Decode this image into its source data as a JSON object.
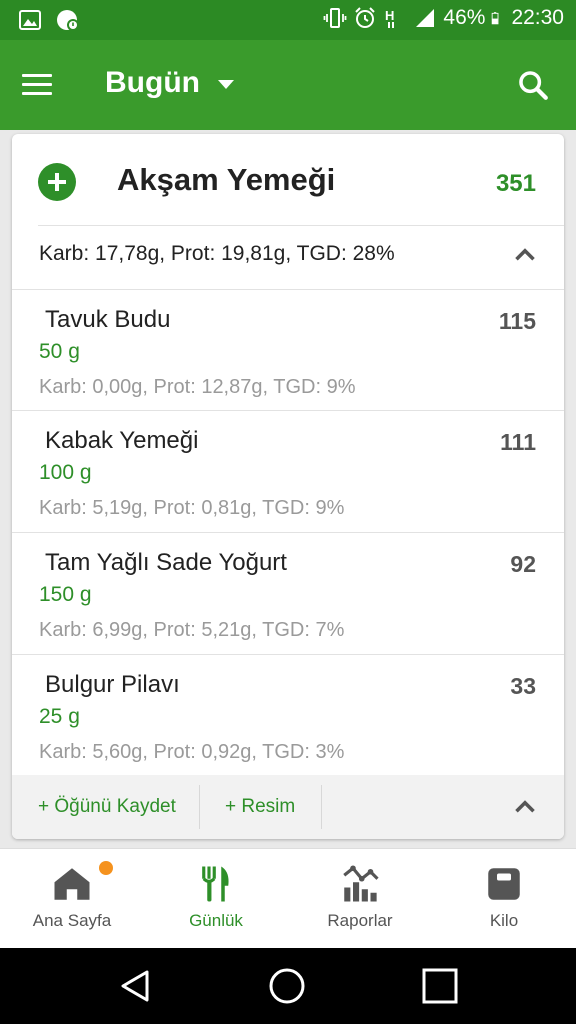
{
  "status_bar": {
    "battery_percent": "46%",
    "time": "22:30",
    "icons": [
      "image-icon",
      "notification-icon",
      "vibrate-icon",
      "alarm-icon",
      "network-h-icon",
      "signal-icon",
      "battery-icon"
    ]
  },
  "app_bar": {
    "title": "Bugün",
    "icons": [
      "menu-icon",
      "dropdown-caret-icon",
      "search-icon"
    ]
  },
  "meal": {
    "title": "Akşam Yemeği",
    "total_kcal": "351",
    "summary": "Karb: 17,78g, Prot: 19,81g, TGD: 28%",
    "items": [
      {
        "name": "Tavuk Budu",
        "qty": "50  g",
        "macros": "Karb: 0,00g, Prot: 12,87g, TGD: 9%",
        "kcal": "115"
      },
      {
        "name": "Kabak Yemeği",
        "qty": "100  g",
        "macros": "Karb: 5,19g, Prot: 0,81g, TGD: 9%",
        "kcal": "111"
      },
      {
        "name": "Tam Yağlı Sade Yoğurt",
        "qty": "150  g",
        "macros": "Karb: 6,99g, Prot: 5,21g, TGD: 7%",
        "kcal": "92"
      },
      {
        "name": "Bulgur Pilavı",
        "qty": "25  g",
        "macros": "Karb: 5,60g, Prot: 0,92g, TGD: 3%",
        "kcal": "33"
      }
    ],
    "footer": {
      "save_label": "+ Öğünü Kaydet",
      "photo_label": "+ Resim"
    }
  },
  "bottom_nav": {
    "items": [
      {
        "label": "Ana Sayfa",
        "icon": "home-icon",
        "has_notification": true
      },
      {
        "label": "Günlük",
        "icon": "fork-knife-icon",
        "active": true
      },
      {
        "label": "Raporlar",
        "icon": "reports-icon"
      },
      {
        "label": "Kilo",
        "icon": "scale-icon"
      }
    ]
  },
  "system_nav": {
    "icons": [
      "back-icon",
      "home-circle-icon",
      "recents-icon"
    ]
  },
  "colors": {
    "status_bar": "#2c8a24",
    "app_bar": "#3a9b2c",
    "accent_green": "#2e8f29",
    "notification_dot": "#f5921e",
    "muted_text": "#9a9a9a"
  }
}
